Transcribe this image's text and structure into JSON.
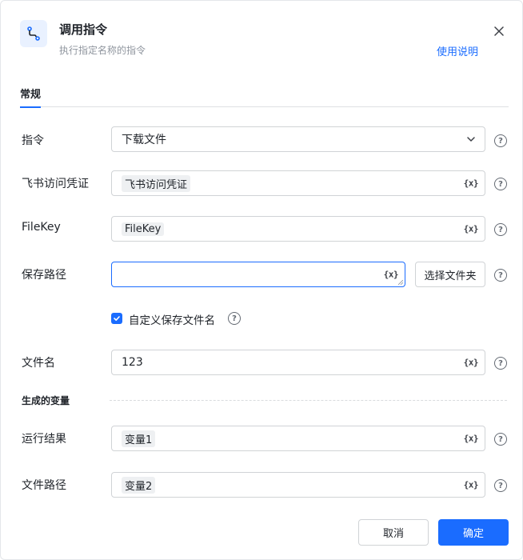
{
  "header": {
    "title": "调用指令",
    "subtitle": "执行指定名称的指令",
    "help_link": "使用说明",
    "icon": "flow-icon"
  },
  "tabs": [
    {
      "label": "常规",
      "active": true
    }
  ],
  "form": {
    "command": {
      "label": "指令",
      "value": "下载文件"
    },
    "credential": {
      "label": "飞书访问凭证",
      "value": "飞书访问凭证"
    },
    "filekey": {
      "label": "FileKey",
      "value": "FileKey"
    },
    "save_path": {
      "label": "保存路径",
      "value": "",
      "browse_label": "选择文件夹"
    },
    "custom_name": {
      "label": "自定义保存文件名",
      "checked": true
    },
    "file_name": {
      "label": "文件名",
      "value": "123"
    }
  },
  "outputs": {
    "section_title": "生成的变量",
    "run_result": {
      "label": "运行结果",
      "value": "变量1"
    },
    "file_path": {
      "label": "文件路径",
      "value": "变量2"
    }
  },
  "footer": {
    "cancel_label": "取消",
    "confirm_label": "确定"
  },
  "icons": {
    "variable_icon_text": "{x}",
    "help_icon_text": "?"
  },
  "colors": {
    "accent": "#1a6cff",
    "border": "#d0d3d6",
    "text": "#1f2329",
    "muted": "#8f959e"
  }
}
